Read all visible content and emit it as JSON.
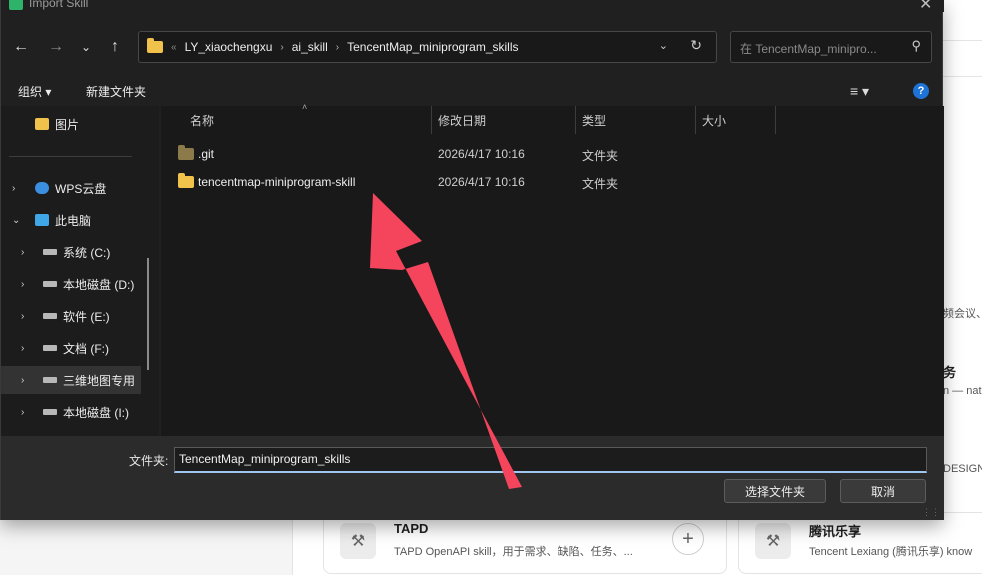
{
  "background": {
    "fragments": [
      "频会议、",
      "务",
      "n — nat",
      "DESIGN"
    ],
    "cards": [
      {
        "title": "TAPD",
        "desc": "TAPD OpenAPI skill，用于需求、缺陷、任务、...",
        "add": "+"
      },
      {
        "title": "腾讯乐享",
        "desc": "Tencent Lexiang (腾讯乐享) know"
      }
    ]
  },
  "dialog": {
    "title": "Import Skill",
    "close": "✕",
    "nav": {
      "back": "←",
      "forward": "→",
      "recent": "⌄",
      "up": "↑"
    },
    "address": {
      "crumbs": [
        "LY_xiaochengxu",
        "ai_skill",
        "TencentMap_miniprogram_skills"
      ],
      "overflow": "«",
      "separator": "›",
      "chevron": "⌄",
      "refresh": "↻"
    },
    "search": {
      "placeholder": "在 TencentMap_miniprogram_skills 中搜索",
      "display": "在 TencentMap_minipro...",
      "icon": "search-icon"
    },
    "toolbar": {
      "organize": "组织 ▾",
      "new_folder": "新建文件夹",
      "view": "≡ ▾",
      "help": "?"
    },
    "navpane": {
      "items": [
        {
          "label": "图片",
          "icon": "folder-icon",
          "expander": ""
        },
        {
          "label": "WPS云盘",
          "icon": "cloud-icon",
          "expander": "›"
        },
        {
          "label": "此电脑",
          "icon": "pc-icon",
          "expander": "⌄"
        },
        {
          "label": "系统 (C:)",
          "icon": "drive-icon",
          "expander": "›"
        },
        {
          "label": "本地磁盘 (D:)",
          "icon": "drive-icon",
          "expander": "›"
        },
        {
          "label": "软件 (E:)",
          "icon": "drive-icon",
          "expander": "›"
        },
        {
          "label": "文档 (F:)",
          "icon": "drive-icon",
          "expander": "›"
        },
        {
          "label": "三维地图专用",
          "icon": "drive-icon",
          "expander": "›"
        },
        {
          "label": "本地磁盘 (I:)",
          "icon": "drive-icon",
          "expander": "›"
        }
      ]
    },
    "filelist": {
      "columns": {
        "name": "名称",
        "modified": "修改日期",
        "type": "类型",
        "size": "大小"
      },
      "sort_caret": "˄",
      "rows": [
        {
          "name": ".git",
          "modified": "2026/4/17 10:16",
          "type": "文件夹"
        },
        {
          "name": "tencentmap-miniprogram-skill",
          "modified": "2026/4/17 10:16",
          "type": "文件夹"
        }
      ]
    },
    "footer": {
      "folder_label": "文件夹:",
      "folder_value": "TencentMap_miniprogram_skills",
      "select_button": "选择文件夹",
      "cancel_button": "取消"
    }
  },
  "annotation_color": "#f5455c"
}
